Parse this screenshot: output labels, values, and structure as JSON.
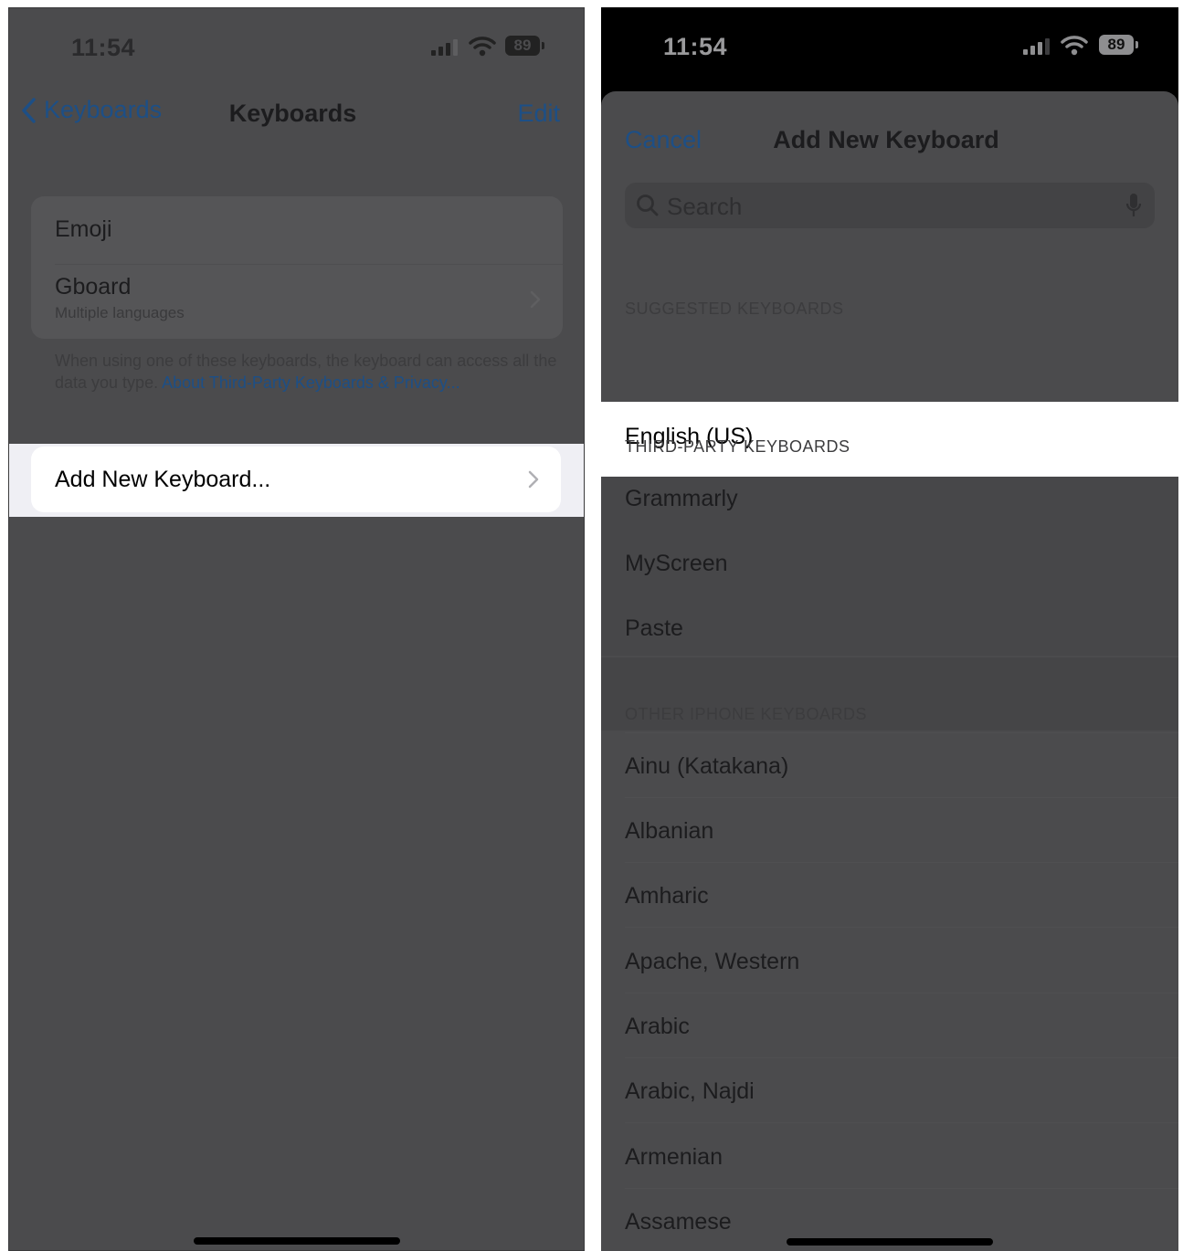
{
  "left": {
    "status": {
      "time": "11:54",
      "battery": "89"
    },
    "nav": {
      "back_label": "Keyboards",
      "title": "Keyboards",
      "edit_label": "Edit"
    },
    "keyboards": [
      {
        "title": "Emoji",
        "subtitle": ""
      },
      {
        "title": "Gboard",
        "subtitle": "Multiple languages"
      }
    ],
    "footnote": {
      "text": "When using one of these keyboards, the keyboard can access all the data you type.",
      "link": "About Third-Party Keyboards & Privacy..."
    },
    "add_new": {
      "label": "Add New Keyboard..."
    }
  },
  "right": {
    "status": {
      "time": "11:54",
      "battery": "89"
    },
    "sheet": {
      "cancel_label": "Cancel",
      "title": "Add New Keyboard",
      "search_placeholder": "Search"
    },
    "suggested": {
      "header": "SUGGESTED KEYBOARDS",
      "items": [
        "English (US)"
      ]
    },
    "third_party": {
      "header": "THIRD-PARTY KEYBOARDS",
      "items": [
        "Grammarly",
        "MyScreen",
        "Paste"
      ]
    },
    "other": {
      "header": "OTHER IPHONE KEYBOARDS",
      "items": [
        "Ainu (Katakana)",
        "Albanian",
        "Amharic",
        "Apache, Western",
        "Arabic",
        "Arabic, Najdi",
        "Armenian",
        "Assamese"
      ]
    }
  },
  "colors": {
    "accent": "#1d4f86",
    "dim_background": "#4b4b4d",
    "highlight": "#ffffff"
  }
}
